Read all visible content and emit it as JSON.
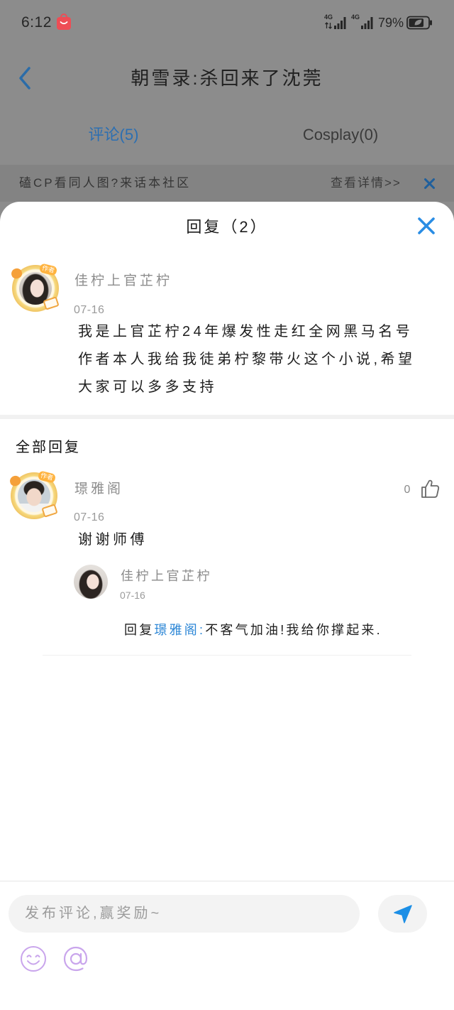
{
  "status_bar": {
    "time": "6:12",
    "signal_1_label": "4G",
    "signal_2_label": "4G",
    "battery": "79%"
  },
  "header": {
    "title": "朝雪录:杀回来了沈莞"
  },
  "tabs": [
    {
      "label": "评论(5)",
      "active": true
    },
    {
      "label": "Cosplay(0)",
      "active": false
    }
  ],
  "banner": {
    "text": "磕CP看同人图?来话本社区",
    "link": "查看详情>>"
  },
  "reply_sheet": {
    "title": "回复（2）",
    "original_comment": {
      "author": "佳柠上官芷柠",
      "badge": "作者",
      "date": "07-16",
      "text_lines": [
        "我是上官芷柠24年爆发性走红全网黑马名号",
        "作者本人我给我徒弟柠黎带火这个小说,希望",
        "大家可以多多支持"
      ]
    },
    "all_replies_heading": "全部回复",
    "replies": [
      {
        "author": "璟雅阁",
        "badge": "作者",
        "date": "07-16",
        "likes": "0",
        "text": "谢谢师傅",
        "sub_replies": [
          {
            "author": "佳柠上官芷柠",
            "date": "07-16",
            "prefix": "回复",
            "reply_to": "璟雅阁:",
            "text": "不客气加油!我给你撑起来."
          }
        ]
      }
    ]
  },
  "composer": {
    "placeholder": "发布评论,赢奖励~"
  },
  "icons": {
    "back": "chevron-left-icon",
    "close": "close-icon",
    "like": "thumbs-up-icon",
    "send": "send-icon",
    "emoji": "emoji-icon",
    "mention": "at-icon",
    "app_badge": "shopping-bag-icon",
    "battery": "battery-icon",
    "signal": "signal-icon"
  },
  "colors": {
    "accent_blue": "#2a8de4",
    "mention_blue": "#2b86d6",
    "emoji_purple": "#c9a5ec",
    "bag_red": "#ee4d55"
  }
}
